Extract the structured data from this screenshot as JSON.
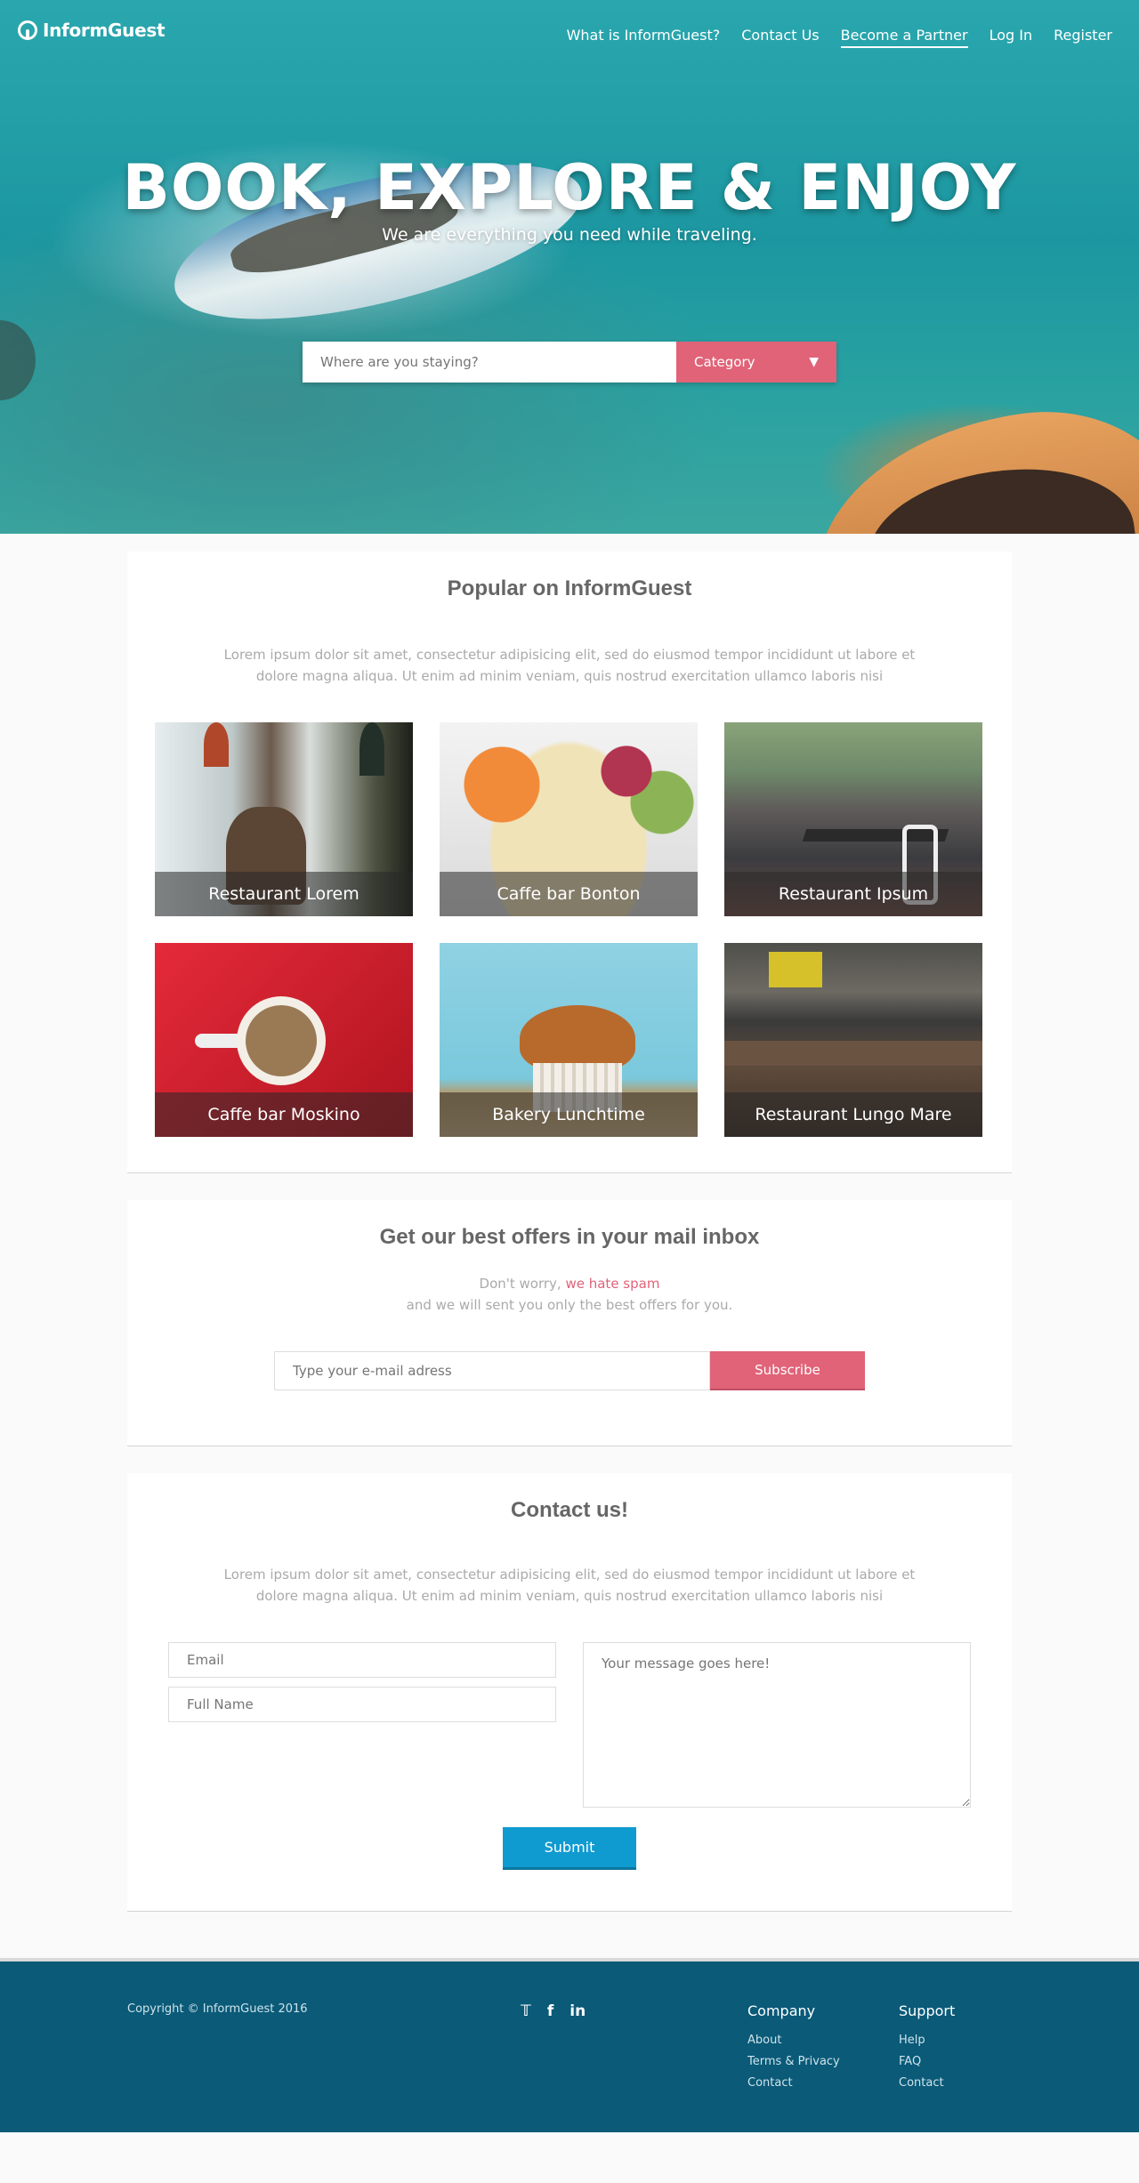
{
  "header": {
    "logo": "InformGuest",
    "nav": [
      "What is InformGuest?",
      "Contact Us",
      "Become a Partner",
      "Log In",
      "Register"
    ],
    "active_nav": "Become a Partner"
  },
  "hero": {
    "title": "BOOK, EXPLORE & ENJOY",
    "subtitle": "We are everything you need while traveling.",
    "search_placeholder": "Where are you staying?",
    "category_label": "Category",
    "category_arrow": "▼"
  },
  "popular": {
    "title": "Popular on InformGuest",
    "description": "Lorem ipsum dolor sit amet, consectetur adipisicing elit, sed do eiusmod tempor incididunt ut labore et dolore magna aliqua. Ut enim ad minim veniam, quis nostrud exercitation ullamco laboris nisi",
    "items": [
      {
        "name": "Restaurant Lorem"
      },
      {
        "name": "Caffe bar Bonton"
      },
      {
        "name": "Restaurant Ipsum"
      },
      {
        "name": "Caffe bar Moskino"
      },
      {
        "name": "Bakery Lunchtime"
      },
      {
        "name": "Restaurant Lungo Mare"
      }
    ]
  },
  "newsletter": {
    "title": "Get our best offers in your mail inbox",
    "line1_prefix": "Don't worry, ",
    "line1_highlight": "we hate spam",
    "line2": "and we will sent you only the best offers for you.",
    "email_placeholder": "Type your e-mail adress",
    "button": "Subscribe"
  },
  "contact": {
    "title": "Contact us!",
    "description": "Lorem ipsum dolor sit amet, consectetur adipisicing elit, sed do eiusmod tempor incididunt ut labore et dolore magna aliqua. Ut enim ad minim veniam, quis nostrud exercitation ullamco laboris nisi",
    "email_placeholder": "Email",
    "name_placeholder": "Full Name",
    "message_placeholder": "Your message goes here!",
    "button": "Submit"
  },
  "footer": {
    "copyright": "Copyright © InformGuest 2016",
    "social_icons": [
      "twitter-icon",
      "facebook-icon",
      "linkedin-icon"
    ],
    "company": {
      "title": "Company",
      "links": [
        "About",
        "Terms & Privacy",
        "Contact"
      ]
    },
    "support": {
      "title": "Support",
      "links": [
        "Help",
        "FAQ",
        "Contact"
      ]
    }
  },
  "colors": {
    "accent": "#e06378",
    "button_blue": "#109bd0",
    "footer": "#0a5a78"
  }
}
